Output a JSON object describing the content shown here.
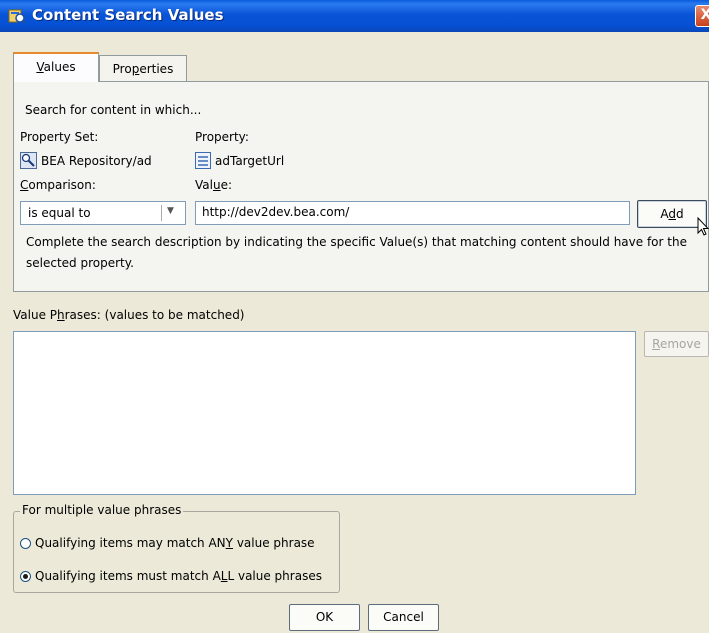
{
  "window": {
    "title": "Content Search Values",
    "title_icon": "content-search-icon",
    "close_label": "X"
  },
  "tabs": [
    {
      "label": "Values",
      "mnemonic": "V",
      "rest": "alues",
      "selected": true
    },
    {
      "label": "Properties",
      "pre": "Pro",
      "mnemonic": "p",
      "rest": "erties",
      "selected": false
    }
  ],
  "values_tab": {
    "intro": "Search for content in which...",
    "property_set_label": "Property Set:",
    "property_set_value": "BEA Repository/ad",
    "property_label": "Property:",
    "property_value": "adTargetUrl",
    "comparison_label_mnemonic": "C",
    "comparison_label_rest": "omparison:",
    "value_label_pre": "Val",
    "value_label_mnemonic": "u",
    "value_label_rest": "e:",
    "comparison_selected": "is equal to",
    "value_input": "http://dev2dev.bea.com/",
    "add_pre": "A",
    "add_mnemonic": "d",
    "add_rest": "d",
    "help_line1": "Complete the search description by indicating the specific Value(s) that matching content should have for the",
    "help_line2": "selected property."
  },
  "value_phrases": {
    "label_pre": "Value P",
    "label_mnemonic": "h",
    "label_rest": "rases:  (values to be matched)",
    "items": [],
    "remove_mnemonic": "R",
    "remove_rest": "emove"
  },
  "multiple_phrases": {
    "legend": "For multiple value phrases",
    "option_any_pre": "Qualifying items may match AN",
    "option_any_mnemonic": "Y",
    "option_any_rest": " value phrase",
    "option_all_pre": "Qualifying items must match A",
    "option_all_mnemonic": "L",
    "option_all_rest": "L value phrases",
    "selected": "all"
  },
  "footer": {
    "ok_label": "OK",
    "cancel_label": "Cancel"
  },
  "colors": {
    "titlebar": "#0a54d8",
    "window_bg": "#ece9d8",
    "tab_accent": "#e68b2c",
    "close_button": "#c8401c"
  }
}
